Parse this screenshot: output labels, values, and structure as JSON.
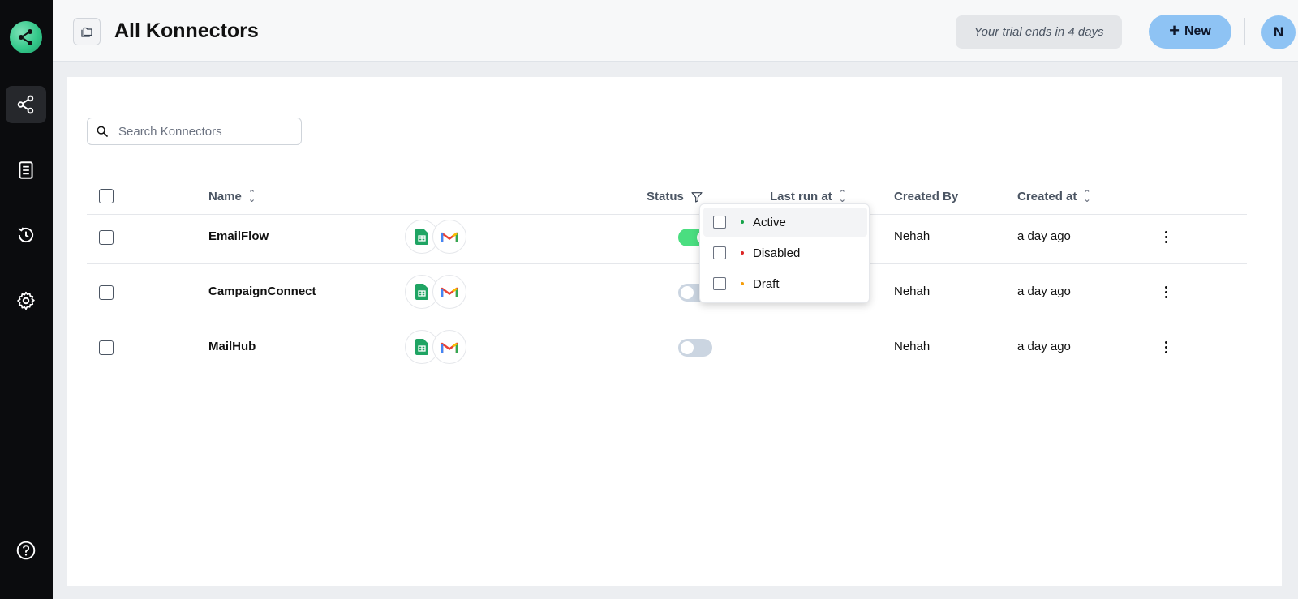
{
  "header": {
    "title": "All Konnectors",
    "trial_text": "Your trial ends in 4 days",
    "new_button": "New",
    "avatar_initial": "N"
  },
  "sidebar": {
    "items": [
      {
        "icon": "share-nodes-icon",
        "active": true
      },
      {
        "icon": "document-icon",
        "active": false
      },
      {
        "icon": "history-icon",
        "active": false
      },
      {
        "icon": "gear-icon",
        "active": false
      },
      {
        "icon": "help-icon",
        "active": false
      }
    ]
  },
  "search": {
    "placeholder": "Search Konnectors"
  },
  "table": {
    "headers": {
      "name": "Name",
      "status": "Status",
      "last_run": "Last run at",
      "created_by": "Created By",
      "created_at": "Created at"
    },
    "rows": [
      {
        "name": "EmailFlow",
        "apps": [
          "google-sheets-icon",
          "gmail-icon"
        ],
        "enabled": true,
        "last_run": "",
        "created_by": "Nehah",
        "created_at": "a day ago"
      },
      {
        "name": "CampaignConnect",
        "apps": [
          "google-sheets-icon",
          "gmail-icon"
        ],
        "enabled": false,
        "last_run": "",
        "created_by": "Nehah",
        "created_at": "a day ago"
      },
      {
        "name": "MailHub",
        "apps": [
          "google-sheets-icon",
          "gmail-icon"
        ],
        "enabled": false,
        "last_run": "",
        "created_by": "Nehah",
        "created_at": "a day ago"
      }
    ]
  },
  "status_filter": {
    "options": [
      {
        "label": "Active",
        "color": "#16a34a"
      },
      {
        "label": "Disabled",
        "color": "#dc2626"
      },
      {
        "label": "Draft",
        "color": "#f59e0b"
      }
    ]
  },
  "colors": {
    "accent": "#8ec3f4",
    "toggle_on": "#4ade80",
    "sidebar_bg": "#0b0c0e"
  }
}
